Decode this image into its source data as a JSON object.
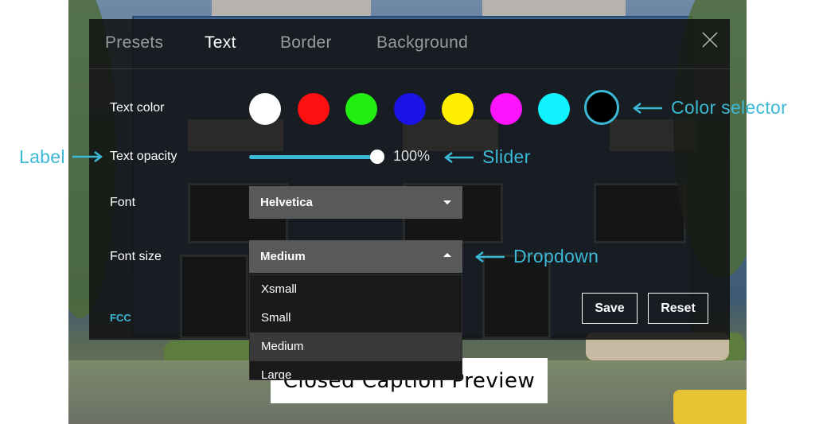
{
  "tabs": [
    {
      "label": "Presets"
    },
    {
      "label": "Text"
    },
    {
      "label": "Border"
    },
    {
      "label": "Background"
    }
  ],
  "active_tab": "Text",
  "rows": {
    "text_color": "Text color",
    "text_opacity": "Text opacity",
    "font": "Font",
    "font_size": "Font size"
  },
  "colors": [
    {
      "name": "white",
      "hex": "#ffffff"
    },
    {
      "name": "red",
      "hex": "#ff1010"
    },
    {
      "name": "green",
      "hex": "#22ee11"
    },
    {
      "name": "blue",
      "hex": "#1a14e6"
    },
    {
      "name": "yellow",
      "hex": "#ffee00"
    },
    {
      "name": "magenta",
      "hex": "#ff14ff"
    },
    {
      "name": "cyan",
      "hex": "#11f2ff"
    },
    {
      "name": "black",
      "hex": "#000000"
    }
  ],
  "selected_color": "black",
  "opacity": {
    "value": 1.0,
    "label": "100%"
  },
  "font_select": {
    "value": "Helvetica"
  },
  "font_size_select": {
    "value": "Medium",
    "options": [
      "Xsmall",
      "Small",
      "Medium",
      "Large"
    ]
  },
  "footer": {
    "fcc": "FCC",
    "save": "Save",
    "reset": "Reset"
  },
  "caption_preview": "Closed Caption Preview",
  "annotations": {
    "color_selector": "Color selector",
    "label": "Label",
    "slider": "Slider",
    "dropdown": "Dropdown"
  },
  "accent": "#3bb9d6",
  "icons": {
    "close": "close-icon",
    "caret_down": "chevron-down-icon",
    "caret_up": "chevron-up-icon"
  }
}
